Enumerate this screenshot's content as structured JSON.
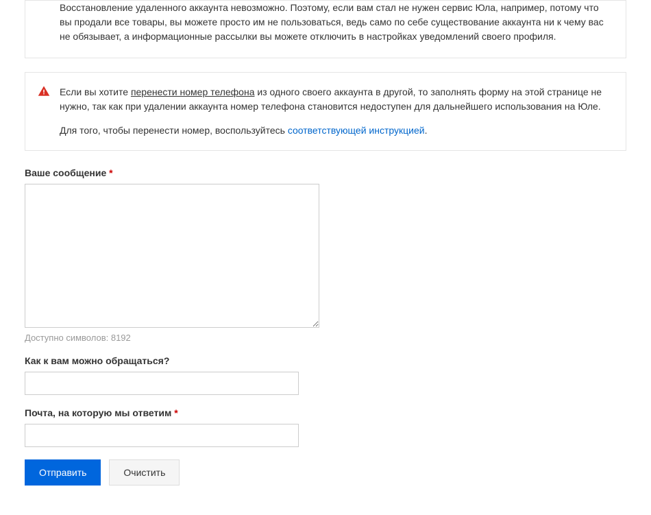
{
  "info": {
    "text": "Восстановление удаленного аккаунта невозможно. Поэтому, если вам стал не нужен сервис Юла, например, потому что вы продали все товары, вы можете просто им не пользоваться, ведь само по себе существование аккаунта ни к чему вас не обязывает, а информационные рассылки вы можете отключить в настройках уведомлений своего профиля."
  },
  "alert": {
    "part1_prefix": "Если вы хотите ",
    "part1_underlined": "перенести номер телефона",
    "part1_suffix": " из одного своего аккаунта в другой, то заполнять форму на этой странице не нужно, так как при удалении аккаунта номер телефона становится недоступен для дальнейшего использования на Юле.",
    "part2_prefix": "Для того, чтобы перенести номер, воспользуйтесь ",
    "part2_link": "соответствующей инструкцией",
    "part2_suffix": "."
  },
  "form": {
    "message_label": "Ваше сообщение",
    "message_value": "",
    "char_counter_prefix": "Доступно символов: ",
    "char_counter_value": "8192",
    "name_label": "Как к вам можно обращаться?",
    "name_value": "",
    "email_label": "Почта, на которую мы ответим",
    "email_value": "",
    "required_marker": "*"
  },
  "buttons": {
    "submit": "Отправить",
    "clear": "Очистить"
  }
}
